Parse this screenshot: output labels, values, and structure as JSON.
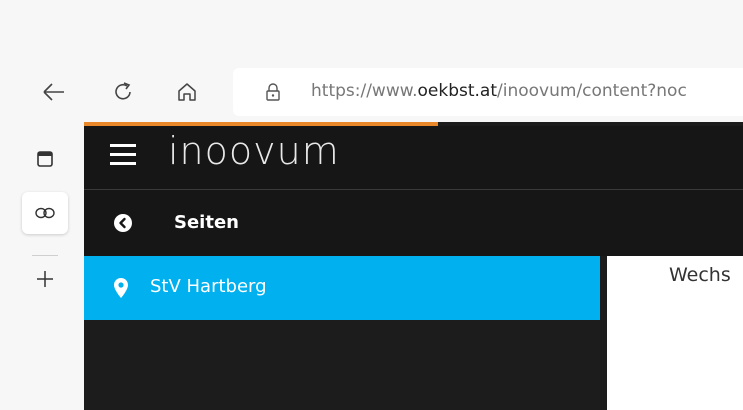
{
  "browser": {
    "url_prefix": "https://www.",
    "url_domain": "oekbst.at",
    "url_rest": "/inoovum/content?noc",
    "icons": {
      "back": "back-arrow-icon",
      "refresh": "refresh-icon",
      "home": "home-icon",
      "lock": "lock-icon"
    },
    "vertical_tabs": [
      {
        "icon": "tab-square-icon"
      },
      {
        "icon": "inoovum-tab-icon",
        "active": true
      },
      {
        "icon": "new-tab-plus-icon"
      }
    ]
  },
  "app": {
    "logo": {
      "left": "in",
      "mid": "oo",
      "right": "vum"
    },
    "breadcrumb_title": "Seiten",
    "sidebar_items": [
      {
        "label": "StV Hartberg"
      }
    ],
    "content_text": "Wechs",
    "colors": {
      "accent_orange": "#e8882b",
      "selected_blue": "#00b0ef",
      "header_bg": "#161616"
    }
  }
}
